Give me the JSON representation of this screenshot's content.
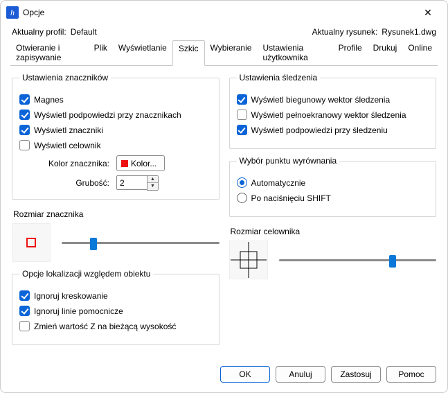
{
  "window": {
    "title": "Opcje"
  },
  "profile": {
    "current_label": "Aktualny profil:",
    "current_value": "Default",
    "drawing_label": "Aktualny rysunek:",
    "drawing_value": "Rysunek1.dwg"
  },
  "tabs": {
    "items": [
      "Otwieranie i zapisywanie",
      "Plik",
      "Wyświetlanie",
      "Szkic",
      "Wybieranie",
      "Ustawienia użytkownika",
      "Profile",
      "Drukuj",
      "Online"
    ],
    "active_index": 3
  },
  "marker_settings": {
    "legend": "Ustawienia znaczników",
    "magnet": "Magnes",
    "show_tips": "Wyświetl podpowiedzi przy znacznikach",
    "show_markers": "Wyświetl znaczniki",
    "show_crosshair": "Wyświetl celownik",
    "color_label": "Kolor znacznika:",
    "color_button": "Kolor...",
    "thickness_label": "Grubość:",
    "thickness_value": "2"
  },
  "marker_size": {
    "label": "Rozmiar znacznika",
    "slider_pct": 18
  },
  "object_loc": {
    "legend": "Opcje lokalizacji względem obiektu",
    "ignore_hatch": "Ignoruj kreskowanie",
    "ignore_guides": "Ignoruj linie pomocnicze",
    "replace_z": "Zmień wartość Z na bieżącą wysokość"
  },
  "tracking": {
    "legend": "Ustawienia śledzenia",
    "polar": "Wyświetl biegunowy wektor śledzenia",
    "fullscreen": "Wyświetl pełnoekranowy wektor śledzenia",
    "tips": "Wyświetl podpowiedzi przy śledzeniu"
  },
  "align_point": {
    "legend": "Wybór punktu wyrównania",
    "auto": "Automatycznie",
    "shift": "Po naciśnięciu SHIFT"
  },
  "crosshair_size": {
    "label": "Rozmiar celownika",
    "slider_pct": 70
  },
  "footer": {
    "ok": "OK",
    "cancel": "Anuluj",
    "apply": "Zastosuj",
    "help": "Pomoc"
  }
}
